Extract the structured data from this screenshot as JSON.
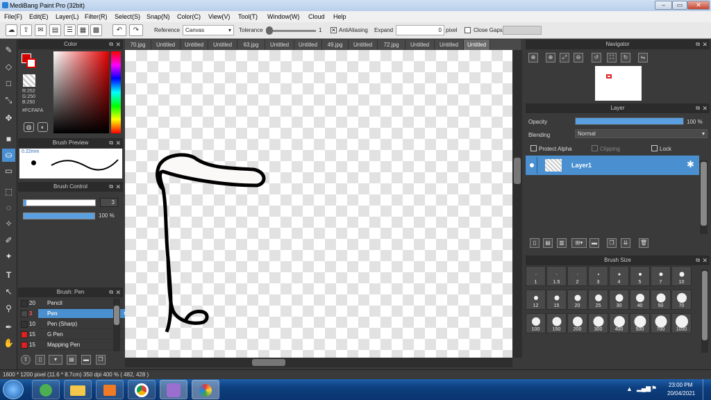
{
  "window": {
    "title": "MediBang Paint Pro (32bit)",
    "min": "–",
    "max": "▭",
    "close": "✕"
  },
  "menu": [
    "File(F)",
    "Edit(E)",
    "Layer(L)",
    "Filter(R)",
    "Select(S)",
    "Snap(N)",
    "Color(C)",
    "View(V)",
    "Tool(T)",
    "Window(W)",
    "Cloud",
    "Help"
  ],
  "toolbar": {
    "reference_label": "Reference",
    "reference_value": "Canvas",
    "tolerance_label": "Tolerance",
    "tolerance_value": "1",
    "antialiasing_label": "AntiAliasing",
    "antialiasing_checked": true,
    "expand_label": "Expand",
    "expand_value": "0",
    "expand_unit": "pixel",
    "close_gaps_label": "Close Gaps",
    "close_gaps_checked": false
  },
  "color_panel": {
    "title": "Color",
    "r": "R:252",
    "g": "G:250",
    "b": "B:250",
    "hex": "#FCFAFA",
    "primary": "#d40000",
    "secondary": "#ffffff"
  },
  "brush_preview": {
    "title": "Brush Preview",
    "size": "0.22mm"
  },
  "brush_control": {
    "title": "Brush Control",
    "size_value": "3",
    "opacity_value": "100 %",
    "opacity_fraction": 1.0
  },
  "brush_list": {
    "title": "Brush: Pen",
    "items": [
      {
        "size": "20",
        "name": "Pencil",
        "color": "#333333",
        "active": false
      },
      {
        "size": "3",
        "name": "Pen",
        "color": "#4a4a4a",
        "active": true
      },
      {
        "size": "10",
        "name": "Pen (Sharp)",
        "color": "#333333",
        "active": false
      },
      {
        "size": "15",
        "name": "G Pen",
        "color": "#e02020",
        "active": false
      },
      {
        "size": "15",
        "name": "Mapping Pen",
        "color": "#e02020",
        "active": false
      }
    ]
  },
  "tabs": [
    "70.jpg",
    "Untitled",
    "Untitled",
    "Untitled",
    "63.jpg",
    "Untitled",
    "Untitled",
    "49.jpg",
    "Untitled",
    "72.jpg",
    "Untitled",
    "Untitled",
    "Untitled"
  ],
  "active_tab": 12,
  "navigator": {
    "title": "Navigator"
  },
  "layer_panel": {
    "title": "Layer",
    "opacity_label": "Opacity",
    "opacity_value": "100 %",
    "opacity_fraction": 1.0,
    "blending_label": "Blending",
    "blending_value": "Normal",
    "protect_alpha": "Protect Alpha",
    "clipping": "Clipping",
    "lock": "Lock",
    "layer_name": "Layer1"
  },
  "brush_size": {
    "title": "Brush Size",
    "sizes": [
      "1",
      "1.5",
      "2",
      "3",
      "4",
      "5",
      "7",
      "10",
      "12",
      "15",
      "20",
      "25",
      "30",
      "40",
      "50",
      "70",
      "100",
      "150",
      "200",
      "300",
      "400",
      "500",
      "700",
      "1000"
    ]
  },
  "status": {
    "text": "1600 * 1200 pixel  (11.6 * 8.7cm)  350 dpi  400 %  ( 482, 428 )"
  },
  "taskbar": {
    "time": "23:00 PM",
    "date": "20/04/2021"
  }
}
